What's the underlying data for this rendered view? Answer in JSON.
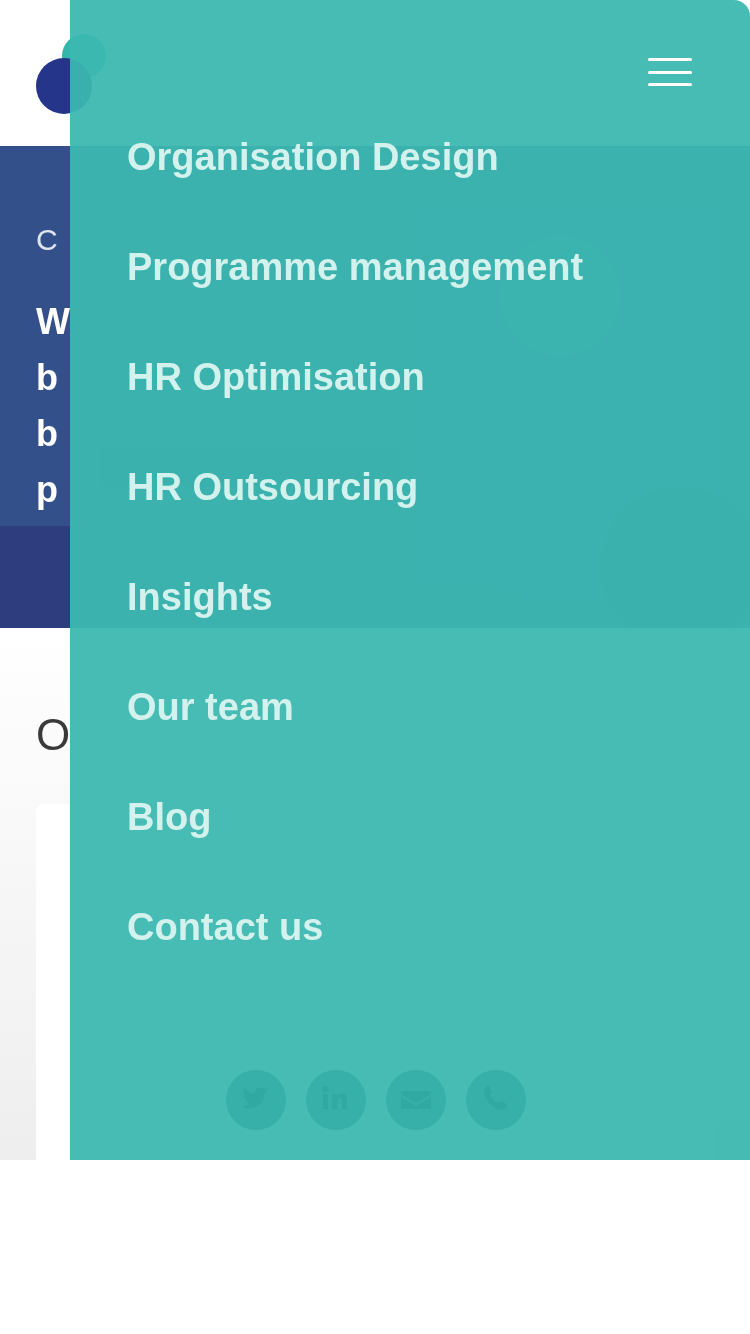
{
  "hero": {
    "eyebrow": "C",
    "heading_lines": [
      "W",
      "b",
      "b",
      "p"
    ]
  },
  "services": {
    "title": "O"
  },
  "menu": {
    "open": true,
    "items": [
      {
        "label": "Organisation Design"
      },
      {
        "label": "Programme management"
      },
      {
        "label": "HR Optimisation"
      },
      {
        "label": "HR Outsourcing"
      },
      {
        "label": "Insights"
      },
      {
        "label": "Our team"
      },
      {
        "label": "Blog"
      },
      {
        "label": "Contact us"
      }
    ],
    "social": [
      {
        "kind": "twitter"
      },
      {
        "kind": "linkedin"
      },
      {
        "kind": "email"
      },
      {
        "kind": "phone"
      }
    ]
  }
}
